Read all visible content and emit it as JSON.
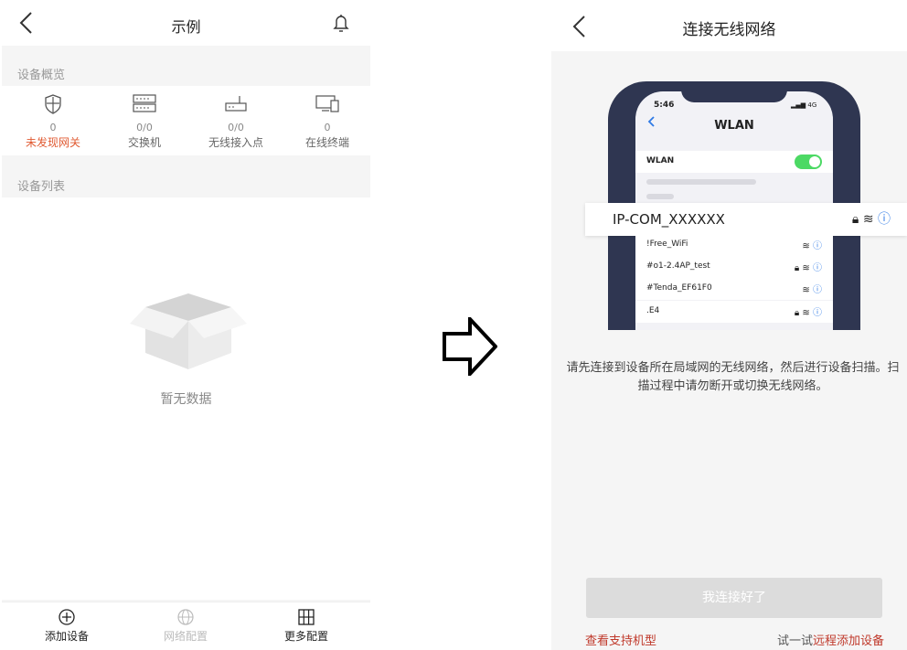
{
  "left_screen": {
    "title": "示例",
    "overview_section": "设备概览",
    "overview_items": [
      {
        "icon": "shield-icon",
        "count": "0",
        "label": "未发现网关"
      },
      {
        "icon": "switch-icon",
        "count": "0/0",
        "label": "交换机"
      },
      {
        "icon": "access-point-icon",
        "count": "0/0",
        "label": "无线接入点"
      },
      {
        "icon": "terminal-icon",
        "count": "0",
        "label": "在线终端"
      }
    ],
    "list_section": "设备列表",
    "empty_text": "暂无数据",
    "tabs": [
      {
        "icon": "add-circle-icon",
        "label": "添加设备"
      },
      {
        "icon": "globe-icon",
        "label": "网络配置"
      },
      {
        "icon": "grid-icon",
        "label": "更多配置"
      }
    ],
    "colors": {
      "alert": "#e05a32"
    }
  },
  "right_screen": {
    "title": "连接无线网络",
    "mock_phone": {
      "time": "5:46",
      "status": "4G",
      "header": "WLAN",
      "wlan_toggle_label": "WLAN",
      "highlighted_network": "IP-COM_XXXXXX",
      "networks": [
        "!Free_WiFi",
        "#o1-2.4AP_test",
        "#Tenda_EF61F0",
        ".E4"
      ]
    },
    "instruction": "请先连接到设备所在局域网的无线网络，然后进行设备扫描。扫描过程中请勿断开或切换无线网络。",
    "connect_button": "我连接好了",
    "support_link": "查看支持机型",
    "remote_prefix": "试一试",
    "remote_link": "远程添加设备",
    "colors": {
      "link": "#c0392b",
      "info": "#2f7ae5",
      "toggle": "#4cd964"
    }
  }
}
